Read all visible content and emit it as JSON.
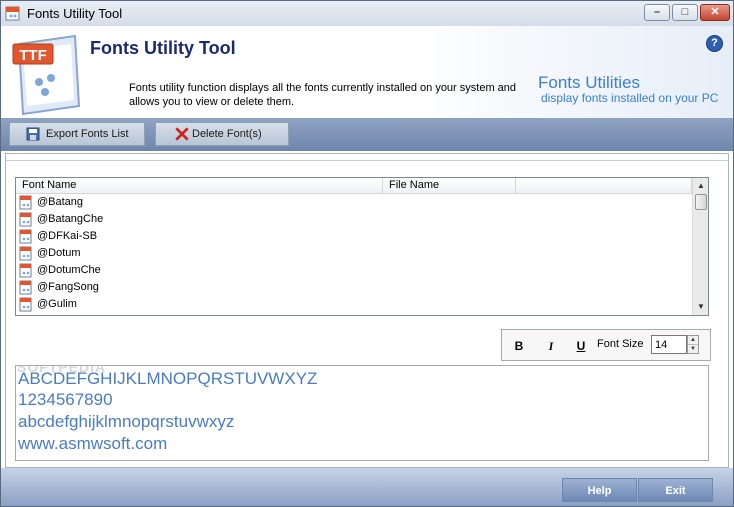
{
  "window": {
    "title": "Fonts Utility Tool"
  },
  "header": {
    "logo_text": "TTF",
    "heading": "Fonts Utility Tool",
    "description": "Fonts utility function displays all the fonts currently installed on your system and allows you to view or delete them.",
    "brand_title": "Fonts Utilities",
    "brand_subtitle": "display fonts installed on your PC",
    "help_glyph": "?"
  },
  "toolbar": {
    "export_label": "Export Fonts List",
    "delete_label": "Delete Font(s)"
  },
  "font_list": {
    "columns": [
      "Font Name",
      "File Name",
      ""
    ],
    "rows": [
      {
        "name": "@Batang",
        "file": ""
      },
      {
        "name": "@BatangChe",
        "file": ""
      },
      {
        "name": "@DFKai-SB",
        "file": ""
      },
      {
        "name": "@Dotum",
        "file": ""
      },
      {
        "name": "@DotumChe",
        "file": ""
      },
      {
        "name": "@FangSong",
        "file": ""
      },
      {
        "name": "@Gulim",
        "file": ""
      }
    ]
  },
  "format": {
    "bold_label": "B",
    "italic_label": "I",
    "underline_label": "U",
    "font_size_label": "Font Size",
    "font_size_value": "14"
  },
  "preview": {
    "watermark": "SOFTPEDIA",
    "line1": "ABCDEFGHIJKLMNOPQRSTUVWXYZ",
    "line2": "1234567890",
    "line3": "abcdefghijklmnopqrstuvwxyz",
    "line4": "www.asmwsoft.com"
  },
  "footer": {
    "help_label": "Help",
    "exit_label": "Exit"
  },
  "colors": {
    "heading": "#1b2a6e",
    "brand": "#3a7fd0",
    "preview_text": "#4a7cc0",
    "toolbar": "#7f94b8"
  }
}
